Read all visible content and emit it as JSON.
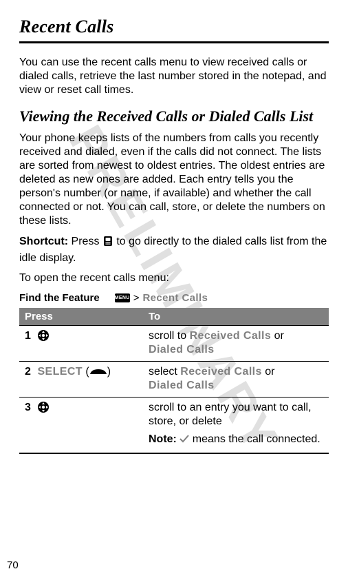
{
  "watermark": "PRELIMINARY",
  "page_number": "70",
  "title": "Recent Calls",
  "intro": "You can use the recent calls menu to view received calls or dialed calls, retrieve the last number stored in the notepad, and view or reset call times.",
  "section_heading": "Viewing the Received Calls or Dialed Calls List",
  "section_body": "Your phone keeps lists of the numbers from calls you recently received and dialed, even if the calls did not connect. The lists are sorted from newest to oldest entries. The oldest entries are deleted as new ones are added. Each entry tells you the person's number (or name, if available) and whether the call connected or not. You can call, store, or delete the numbers on these lists.",
  "shortcut_label": "Shortcut:",
  "shortcut_text_before": " Press ",
  "shortcut_text_after": " to go directly to the dialed calls list from the idle display.",
  "open_menu_line": "To open the recent calls menu:",
  "find_feature_label": "Find the Feature",
  "menu_badge": "MENU",
  "find_feature_sep": ">",
  "find_feature_path": "Recent Calls",
  "table": {
    "headers": {
      "press": "Press",
      "to": "To"
    },
    "rows": [
      {
        "num": "1",
        "press_kind": "nav",
        "to_prefix": "scroll to ",
        "to_opt1": "Received Calls",
        "to_join": " or ",
        "to_opt2": "Dialed Calls"
      },
      {
        "num": "2",
        "press_kind": "select",
        "press_label": "SELECT",
        "press_paren_open": " (",
        "press_paren_close": ")",
        "to_prefix": "select ",
        "to_opt1": "Received Calls",
        "to_join": " or ",
        "to_opt2": "Dialed Calls"
      },
      {
        "num": "3",
        "press_kind": "nav",
        "to_text": "scroll to an entry you want to call, store, or delete"
      }
    ],
    "note_label": "Note:",
    "note_after": " means the call connected."
  }
}
